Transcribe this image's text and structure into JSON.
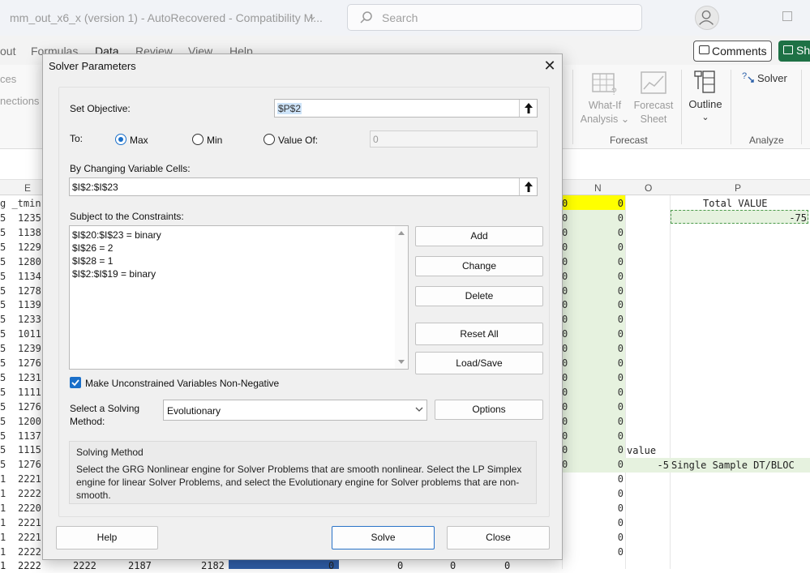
{
  "titlebar": {
    "doc_title": "mm_out_x6_x (version 1)  -  AutoRecovered  -  Compatibility M...",
    "search_placeholder": "Search"
  },
  "ribbon_tabs": [
    "out",
    "Formulas",
    "Data",
    "Review",
    "View",
    "Help"
  ],
  "header_buttons": {
    "comments": "Comments",
    "share": "Sh"
  },
  "ribbon_left_items": [
    "ces",
    "nections"
  ],
  "ribbon": {
    "what_if": [
      "What-If",
      "Analysis ⌄"
    ],
    "forecast_sheet": [
      "Forecast",
      "Sheet"
    ],
    "outline": [
      "Outline",
      "⌄"
    ],
    "solver": "Solver",
    "group_forecast": "Forecast",
    "group_analyze": "Analyze"
  },
  "columns": [
    "E",
    "N",
    "O",
    "P"
  ],
  "grid": {
    "e_header_text": "g _tmin",
    "row_prefix": [
      "5",
      "5",
      "5",
      "5",
      "5",
      "5",
      "5",
      "5",
      "5",
      "5",
      "5",
      "5",
      "5",
      "5",
      "5",
      "5",
      "5",
      "5",
      "1",
      "1",
      "1",
      "1",
      "1",
      "1",
      "1"
    ],
    "e_values": [
      "1235",
      "1138",
      "1229",
      "1280",
      "1134",
      "1278",
      "1139",
      "1233",
      "1011",
      "1239",
      "1276",
      "1231",
      "1111",
      "1276",
      "1200",
      "1137",
      "1115",
      "1276",
      "2221",
      "2222",
      "2220",
      "2221",
      "2221",
      "2222",
      "2222"
    ],
    "m_values": [
      "0",
      "0",
      "0",
      "0",
      "0",
      "0",
      "0",
      "0",
      "0",
      "0",
      "0",
      "0",
      "0",
      "0",
      "0",
      "0",
      "0",
      "0",
      "0",
      "",
      "",
      "",
      "",
      "",
      "",
      ""
    ],
    "n_values": [
      "0",
      "0",
      "0",
      "0",
      "0",
      "0",
      "0",
      "0",
      "0",
      "0",
      "0",
      "0",
      "0",
      "0",
      "0",
      "0",
      "0",
      "0",
      "0",
      "0",
      "0",
      "0",
      "0",
      "0",
      "0",
      "0"
    ],
    "p_header": "Total VALUE",
    "p_value": "-75",
    "value_label": "value",
    "o_value": "-5",
    "p_label": "Single Sample DT/BLOC",
    "bottom_row": [
      "2222",
      "2187",
      "2182",
      "0",
      "0",
      "0",
      "0"
    ]
  },
  "dialog": {
    "title": "Solver Parameters",
    "set_objective_label": "Set Objective:",
    "objective_value": "$P$2",
    "to_label": "To:",
    "max_label": "Max",
    "min_label": "Min",
    "value_of_label": "Value Of:",
    "value_of_value": "0",
    "changing_label": "By Changing Variable Cells:",
    "changing_value": "$I$2:$I$23",
    "constraints_label": "Subject to the Constraints:",
    "constraints": [
      "$I$20:$I$23 = binary",
      "$I$26 = 2",
      "$I$28 = 1",
      "$I$2:$I$19 = binary"
    ],
    "buttons": {
      "add": "Add",
      "change": "Change",
      "delete": "Delete",
      "reset_all": "Reset All",
      "load_save": "Load/Save",
      "options": "Options",
      "help": "Help",
      "solve": "Solve",
      "close": "Close"
    },
    "nonneg_label": "Make Unconstrained Variables Non-Negative",
    "method_label_1": "Select a Solving",
    "method_label_2": "Method:",
    "method_value": "Evolutionary",
    "method_box_title": "Solving Method",
    "method_box_desc": "Select the GRG Nonlinear engine for Solver Problems that are smooth nonlinear. Select the LP Simplex engine for linear Solver Problems, and select the Evolutionary engine for Solver problems that are non-smooth."
  },
  "colors": {
    "excel_green": "#1e7145",
    "selection_green": "#e6f2df",
    "highlight_yellow": "#ffff00",
    "accent_blue": "#1a6fc9"
  }
}
